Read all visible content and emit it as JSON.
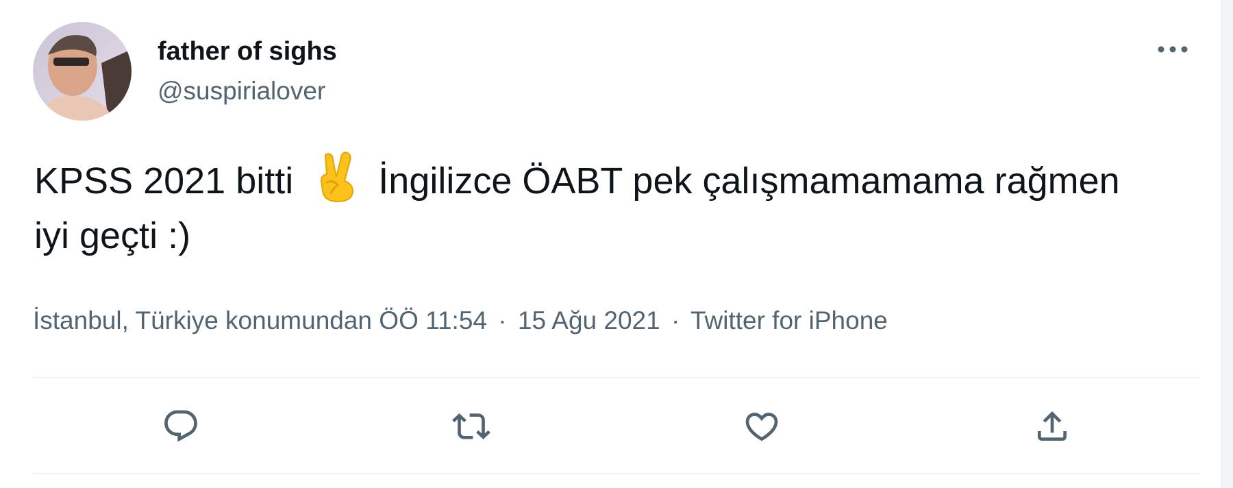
{
  "tweet": {
    "author": {
      "display_name": "father of sighs",
      "handle": "@suspirialover"
    },
    "text_part1": "KPSS 2021 bitti",
    "emoji": "victory-hand-emoji",
    "text_part2": "İngilizce ÖABT pek çalışmamamama rağmen iyi geçti :)",
    "meta": {
      "location": "İstanbul, Türkiye konumundan",
      "time": "ÖÖ 11:54",
      "date": "15 Ağu 2021",
      "source": "Twitter for iPhone",
      "separator": "·"
    },
    "actions": [
      {
        "name": "reply-icon"
      },
      {
        "name": "retweet-icon"
      },
      {
        "name": "like-icon"
      },
      {
        "name": "share-icon"
      }
    ]
  },
  "colors": {
    "text_primary": "#0f1419",
    "text_secondary": "#536471",
    "divider": "#eff3f4"
  }
}
